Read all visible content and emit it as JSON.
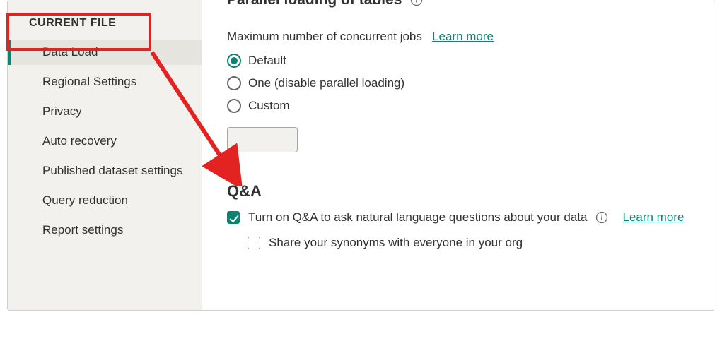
{
  "sidebar": {
    "header": "CURRENT FILE",
    "items": [
      {
        "label": "Data Load"
      },
      {
        "label": "Regional Settings"
      },
      {
        "label": "Privacy"
      },
      {
        "label": "Auto recovery"
      },
      {
        "label": "Published dataset settings"
      },
      {
        "label": "Query reduction"
      },
      {
        "label": "Report settings"
      }
    ]
  },
  "parallel": {
    "title_partial": "Parallel loading of tables",
    "row_label": "Maximum number of concurrent jobs",
    "learn_more": "Learn more",
    "options": [
      {
        "label": "Default"
      },
      {
        "label": "One (disable parallel loading)"
      },
      {
        "label": "Custom"
      }
    ],
    "custom_value": ""
  },
  "qa": {
    "heading": "Q&A",
    "turn_on": "Turn on Q&A to ask natural language questions about your data",
    "share_syn": "Share your synonyms with everyone in your org",
    "learn_more": "Learn more"
  }
}
